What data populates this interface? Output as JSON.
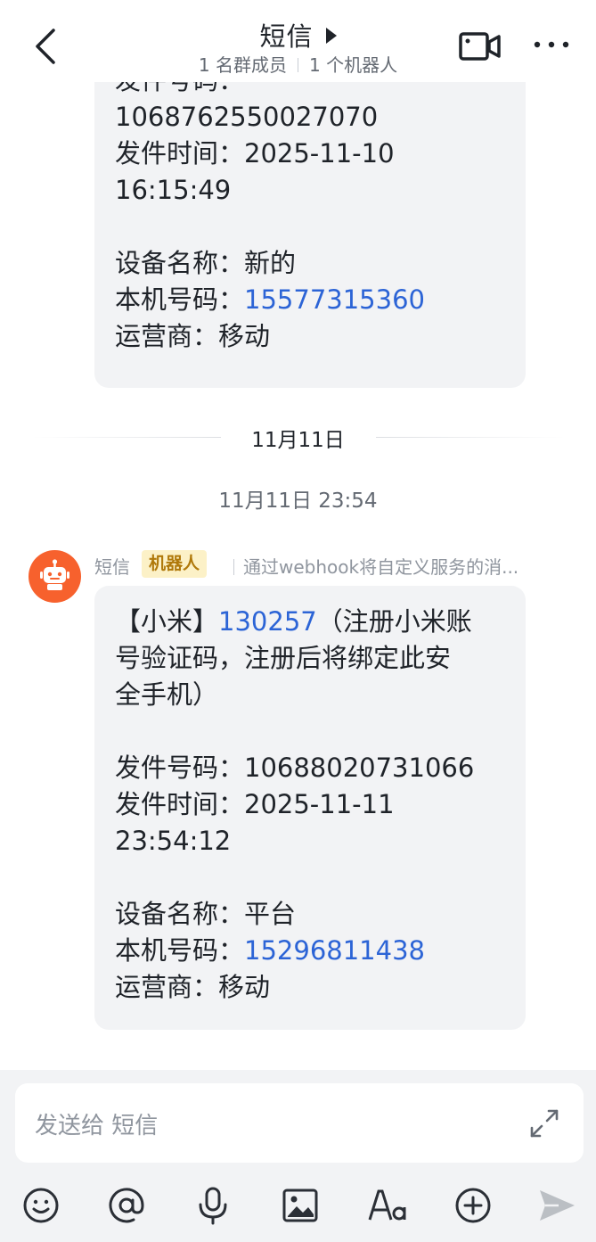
{
  "header": {
    "title": "短信",
    "members": "1 名群成员",
    "bots": "1 个机器人"
  },
  "messages": [
    {
      "lines": [
        "发件号码：",
        "1068762550027070",
        "发件时间：2025-11-10",
        "16:15:49",
        "",
        "设备名称：新的",
        "本机号码：",
        "运营商：移动"
      ],
      "phone": "15577315360"
    }
  ],
  "date_divider": "11月11日",
  "timestamp": "11月11日 23:54",
  "sender": {
    "name": "短信",
    "tag": "机器人",
    "description": "通过webhook将自定义服务的消..."
  },
  "message2": {
    "line1_prefix": "【小米】",
    "code": "130257",
    "line1_suffix": "（注册小米账",
    "line2": "号验证码，注册后将绑定此安",
    "line3": "全手机）",
    "line4": "",
    "line5": "发件号码：10688020731066",
    "line6": "发件时间：2025-11-11",
    "line7": "23:54:12",
    "line8": "",
    "line9": "设备名称：平台",
    "line10_prefix": "本机号码：",
    "phone": "15296811438",
    "line11": "运营商：移动"
  },
  "composer": {
    "placeholder": "发送给 短信"
  },
  "colors": {
    "link": "#2c64d6",
    "avatar": "#f7612d",
    "robot_tag_bg": "#fcf1c7",
    "robot_tag_text": "#b0790b"
  },
  "icons": [
    "back-icon",
    "caret-right-icon",
    "video-call-icon",
    "more-icon",
    "robot-icon",
    "expand-icon",
    "emoji-icon",
    "at-icon",
    "microphone-icon",
    "image-icon",
    "text-format-icon",
    "plus-circle-icon",
    "send-icon"
  ]
}
